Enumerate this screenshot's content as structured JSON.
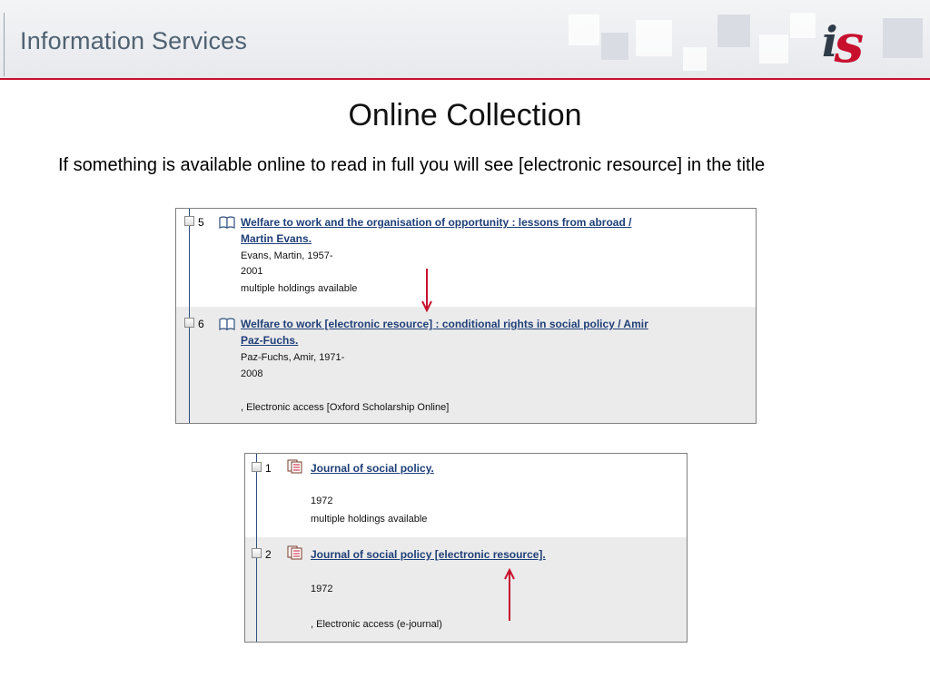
{
  "header": {
    "title": "Information Services",
    "logo_text": "is"
  },
  "slide": {
    "title": "Online Collection",
    "intro": "If something is available online to read in full you will see [electronic resource] in the title"
  },
  "screenshot1": {
    "records": [
      {
        "number": "5",
        "icon": "book-icon",
        "title_line1": "Welfare to work and the organisation of opportunity : lessons from abroad /",
        "title_line2": "Martin Evans.",
        "author": "Evans, Martin, 1957-",
        "year": "2001",
        "holdings": "multiple holdings available"
      },
      {
        "number": "6",
        "icon": "book-icon",
        "title_line1": "Welfare to work [electronic resource] : conditional rights in social policy / Amir",
        "title_line2": "Paz-Fuchs.",
        "author": "Paz-Fuchs, Amir, 1971-",
        "year": "2008",
        "access": ", Electronic access [Oxford Scholarship Online]"
      }
    ]
  },
  "screenshot2": {
    "records": [
      {
        "number": "1",
        "icon": "journal-icon",
        "title": "Journal of social policy.",
        "year": "1972",
        "holdings": "multiple holdings available"
      },
      {
        "number": "2",
        "icon": "journal-icon",
        "title": "Journal of social policy [electronic resource].",
        "year": "1972",
        "access": ", Electronic access (e-journal)"
      }
    ]
  },
  "colors": {
    "accent_red": "#c8102e",
    "link_blue": "#1f3f78",
    "header_text": "#4f6272"
  }
}
